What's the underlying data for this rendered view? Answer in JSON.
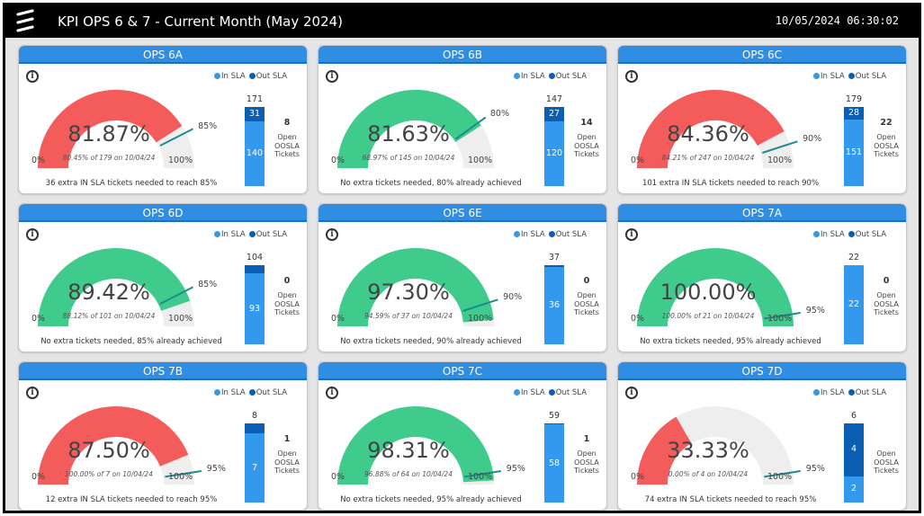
{
  "header": {
    "title": "KPI OPS 6 & 7 - Current Month (May 2024)",
    "timestamp": "10/05/2024 06:30:02"
  },
  "legend": {
    "in_sla": "In SLA",
    "out_sla": "Out SLA"
  },
  "labels": {
    "zero": "0%",
    "hundred": "100%",
    "oos_label": "Open OOSLA Tickets"
  },
  "colors": {
    "header_blue": "#2f8de4",
    "gauge_red": "#f45b5b",
    "gauge_green": "#3ecb8c",
    "gauge_track": "#eeeeee",
    "target_teal": "#1e8c8c",
    "in_sla_bar": "#3399ee",
    "out_sla_bar": "#0b5fb3"
  },
  "cards": [
    {
      "title": "OPS 6A",
      "pct_text": "81.87%",
      "pct": 81.87,
      "target": 85,
      "target_text": "85%",
      "subtitle": "80.45% of 179 on 10/04/24",
      "total": "171",
      "in_sla": "140",
      "out_sla": "31",
      "in_val": 140,
      "out_val": 31,
      "oos": "8",
      "status": "red",
      "message": "36 extra IN SLA tickets needed to reach 85%"
    },
    {
      "title": "OPS 6B",
      "pct_text": "81.63%",
      "pct": 81.63,
      "target": 80,
      "target_text": "80%",
      "subtitle": "68.97% of 145 on 10/04/24",
      "total": "147",
      "in_sla": "120",
      "out_sla": "27",
      "in_val": 120,
      "out_val": 27,
      "oos": "14",
      "status": "green",
      "message": "No extra tickets needed, 80% already achieved"
    },
    {
      "title": "OPS 6C",
      "pct_text": "84.36%",
      "pct": 84.36,
      "target": 90,
      "target_text": "90%",
      "subtitle": "84.21% of 247 on 10/04/24",
      "total": "179",
      "in_sla": "151",
      "out_sla": "28",
      "in_val": 151,
      "out_val": 28,
      "oos": "22",
      "status": "red",
      "message": "101 extra IN SLA tickets needed to reach 90%"
    },
    {
      "title": "OPS 6D",
      "pct_text": "89.42%",
      "pct": 89.42,
      "target": 85,
      "target_text": "85%",
      "subtitle": "88.12% of 101 on 10/04/24",
      "total": "104",
      "in_sla": "93",
      "out_sla": "",
      "in_val": 93,
      "out_val": 11,
      "oos": "0",
      "status": "green",
      "message": "No extra tickets needed, 85% already achieved"
    },
    {
      "title": "OPS 6E",
      "pct_text": "97.30%",
      "pct": 97.3,
      "target": 90,
      "target_text": "90%",
      "subtitle": "94.59% of 37 on 10/04/24",
      "total": "37",
      "in_sla": "36",
      "out_sla": "",
      "in_val": 36,
      "out_val": 1,
      "oos": "0",
      "status": "green",
      "message": "No extra tickets needed, 90% already achieved"
    },
    {
      "title": "OPS 7A",
      "pct_text": "100.00%",
      "pct": 100,
      "target": 95,
      "target_text": "95%",
      "subtitle": "100.00% of 21 on 10/04/24",
      "total": "22",
      "in_sla": "22",
      "out_sla": "",
      "in_val": 22,
      "out_val": 0,
      "oos": "0",
      "status": "green",
      "message": "No extra tickets needed, 95% already achieved"
    },
    {
      "title": "OPS 7B",
      "pct_text": "87.50%",
      "pct": 87.5,
      "target": 95,
      "target_text": "95%",
      "subtitle": "100.00% of 7 on 10/04/24",
      "total": "8",
      "in_sla": "7",
      "out_sla": "",
      "in_val": 7,
      "out_val": 1,
      "oos": "1",
      "status": "red",
      "message": "12 extra IN SLA tickets needed to reach 95%"
    },
    {
      "title": "OPS 7C",
      "pct_text": "98.31%",
      "pct": 98.31,
      "target": 95,
      "target_text": "95%",
      "subtitle": "96.88% of 64 on 10/04/24",
      "total": "59",
      "in_sla": "58",
      "out_sla": "",
      "in_val": 58,
      "out_val": 1,
      "oos": "1",
      "status": "green",
      "message": "No extra tickets needed, 95% already achieved"
    },
    {
      "title": "OPS 7D",
      "pct_text": "33.33%",
      "pct": 33.33,
      "target": 95,
      "target_text": "95%",
      "subtitle": "0.00% of 4 on 10/04/24",
      "total": "6",
      "in_sla": "2",
      "out_sla": "4",
      "in_val": 2,
      "out_val": 4,
      "oos": "",
      "status": "red",
      "message": "74 extra IN SLA tickets needed to reach 95%"
    }
  ]
}
